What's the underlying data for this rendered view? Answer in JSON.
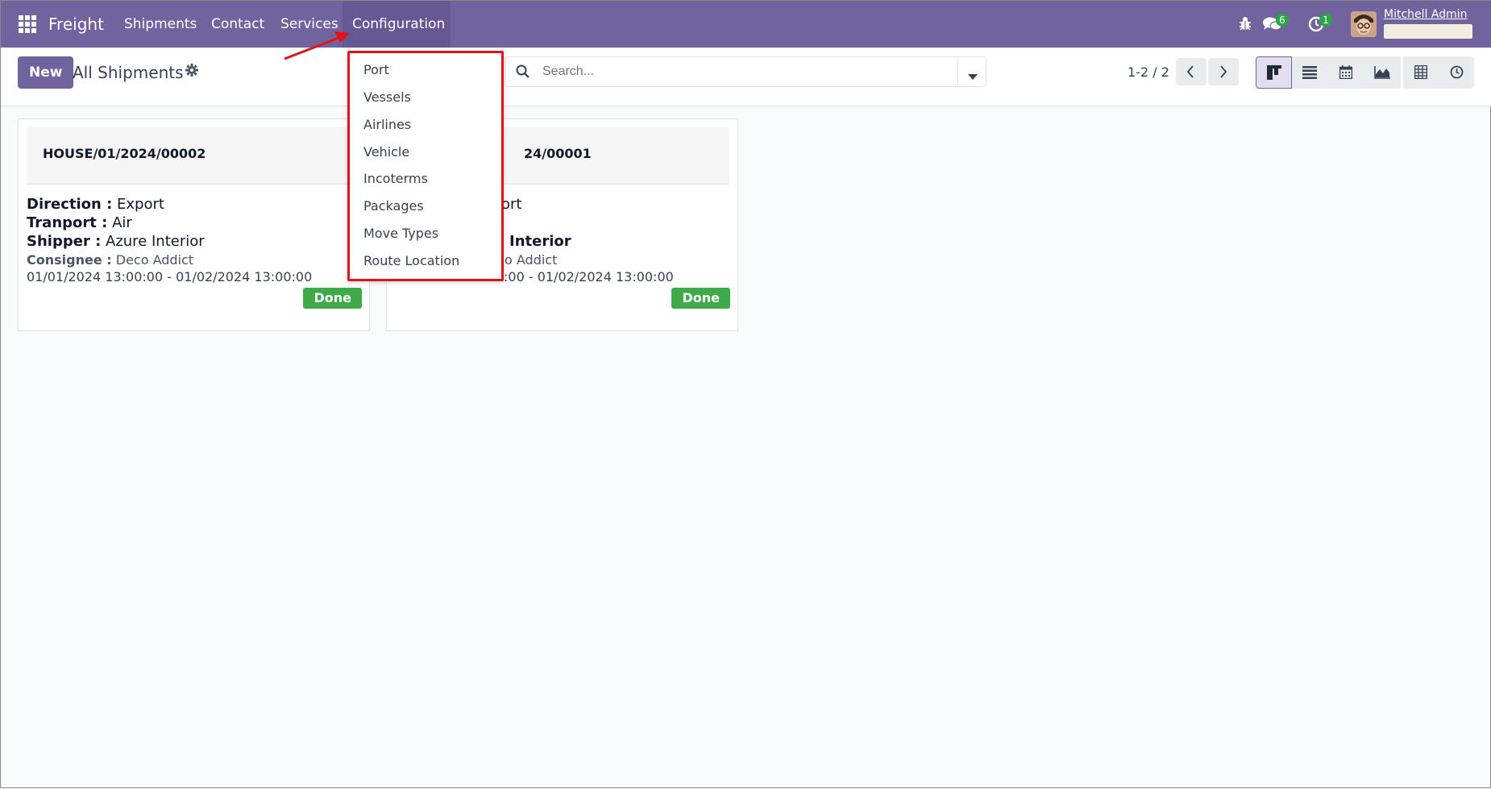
{
  "navbar": {
    "brand": "Freight",
    "menus": [
      "Shipments",
      "Contact",
      "Services",
      "Configuration"
    ],
    "messages_count": "6",
    "activities_count": "1",
    "user_name": "Mitchell Admin"
  },
  "control_panel": {
    "new_label": "New",
    "title": "All Shipments",
    "search_placeholder": "Search...",
    "pager": "1-2 / 2",
    "views": [
      "kanban-icon",
      "list-icon",
      "calendar-icon",
      "graph-icon",
      "pivot-icon",
      "activity-icon"
    ]
  },
  "configuration_menu": {
    "items": [
      "Port",
      "Vessels",
      "Airlines",
      "Vehicle",
      "Incoterms",
      "Packages",
      "Move Types",
      "Route Location"
    ]
  },
  "cards": [
    {
      "ref": "HOUSE/01/2024/00002",
      "direction_label": "Direction :",
      "direction": "Export",
      "transport_label": "Tranport :",
      "transport": "Air",
      "shipper_label": "Shipper :",
      "shipper": "Azure Interior",
      "consignee_label": "Consignee :",
      "consignee": "Deco Addict",
      "dates": "01/01/2024 13:00:00 - 01/02/2024 13:00:00",
      "status": "Done"
    },
    {
      "ref": "24/00001",
      "direction": "ort",
      "shipper": "Interior",
      "consignee": "o Addict",
      "dates": ":00 - 01/02/2024 13:00:00",
      "status": "Done"
    }
  ],
  "colors": {
    "navbar": "#71639e",
    "highlight": "#e3121a",
    "done": "#3faa4a"
  }
}
